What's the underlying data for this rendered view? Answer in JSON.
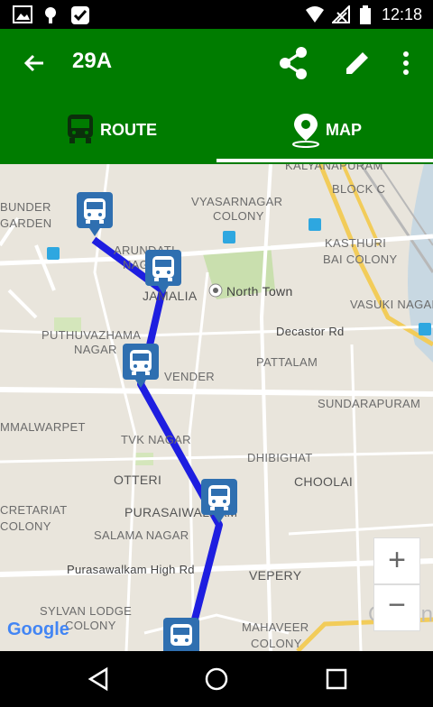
{
  "status_bar": {
    "time": "12:18"
  },
  "toolbar": {
    "title": "29A"
  },
  "tabs": [
    {
      "label": "ROUTE"
    },
    {
      "label": "MAP"
    }
  ],
  "map": {
    "labels": [
      "KALYANAPURAM",
      "BLOCK C",
      "VYASARNAGAR",
      "COLONY",
      "BUNDER",
      "GARDEN",
      "KASTHURI",
      "BAI COLONY",
      "ARUNDATI",
      "NAGAR",
      "JAMALIA",
      "North Town",
      "VASUKI NAGAR",
      "PUTHUVAZHAMA",
      "NAGAR",
      "Decastor Rd",
      "PATTALAM",
      "VENDER",
      "SUNDARAPURAM",
      "MMALWARPET",
      "TVK NAGAR",
      "DHIBIGHAT",
      "OTTERI",
      "CHOOLAI",
      "CRETARIAT",
      "COLONY",
      "PURASAIWALKAM",
      "SALAMA NAGAR",
      "Purasawalkam High Rd",
      "VEPERY",
      "SYLVAN LODGE",
      "COLONY",
      "MAHAVEER",
      "COLONY",
      "Chenn"
    ],
    "zoom_in": "+",
    "zoom_out": "−",
    "attribution": "Google"
  },
  "colors": {
    "app_green": "#007c00",
    "route_blue": "#1e1ee0",
    "marker_blue": "#2f6fb0"
  }
}
